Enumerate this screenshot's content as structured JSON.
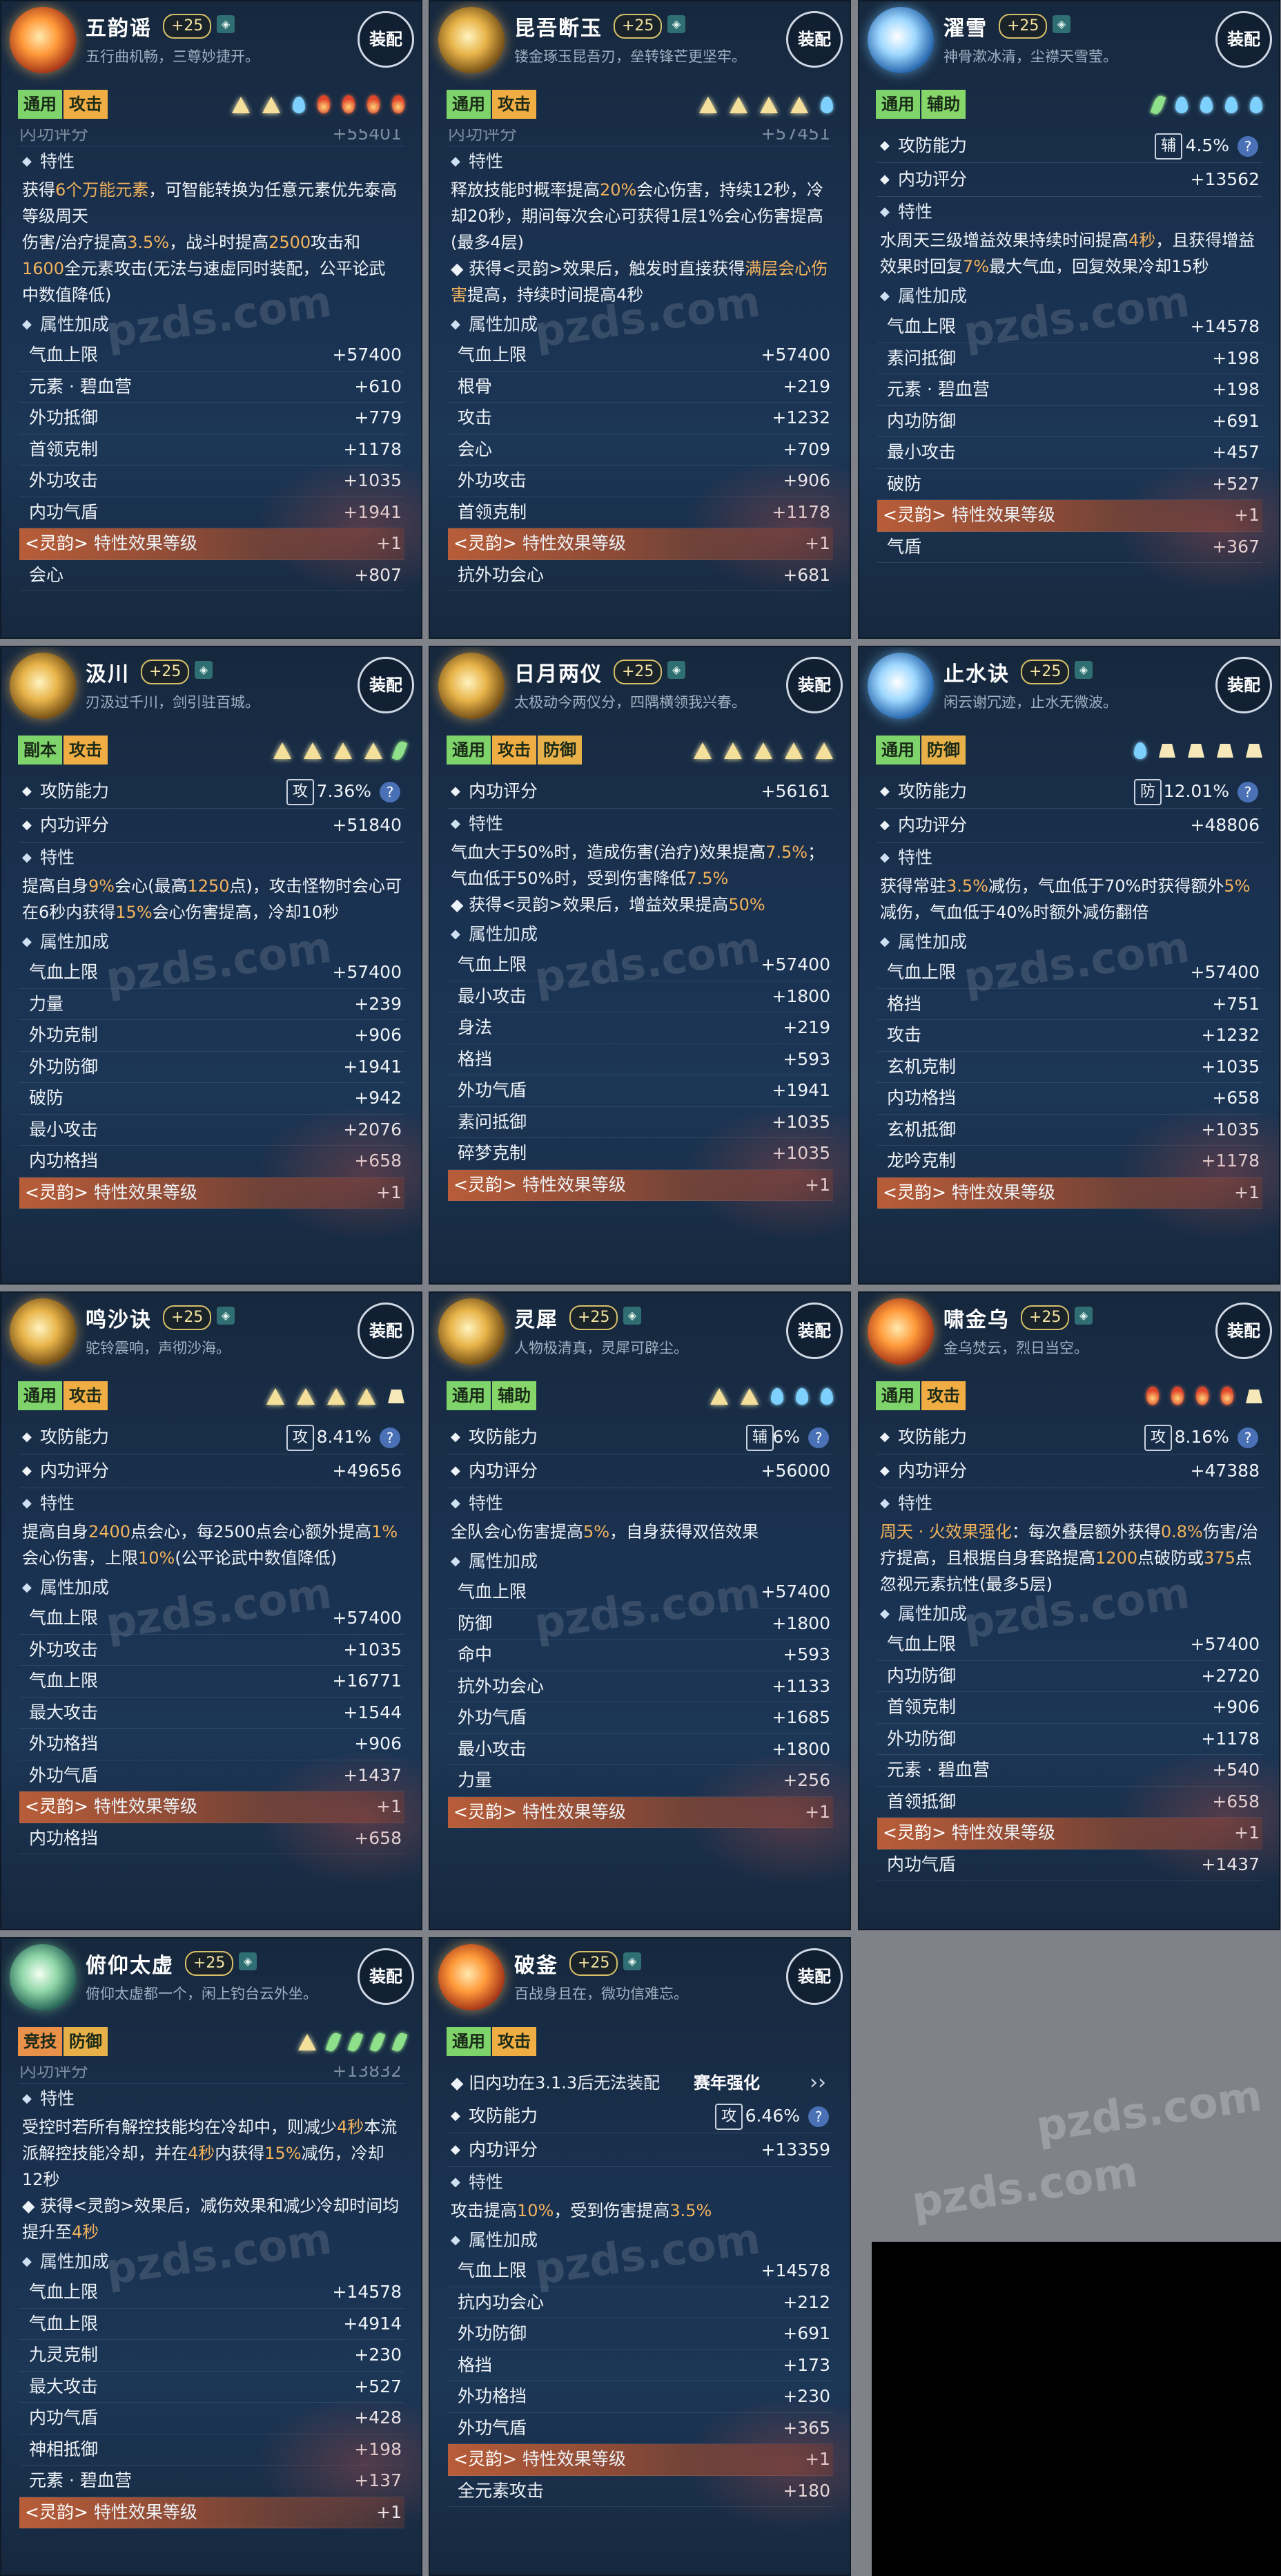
{
  "equip_label": "装配",
  "section_labels": {
    "trait": "特性",
    "attributes": "属性加成",
    "attack_defense": "攻防能力",
    "inner_score": "内功评分"
  },
  "watermark_text": "pzds.com",
  "cards": [
    {
      "name": "五韵谣",
      "plus": "+25",
      "motto": "五行曲机畅，三尊妙捷开。",
      "emblem": "fire",
      "tags": [
        {
          "label": "通用",
          "type": "general"
        },
        {
          "label": "攻击",
          "type": "attack"
        }
      ],
      "gems": [
        "tri",
        "tri",
        "drop",
        "flame",
        "flame",
        "flame",
        "flame"
      ],
      "top_row": {
        "label": "内功评分",
        "value": "+55401",
        "dimmed": true
      },
      "trait_html": "获得<span class='hl'>6个万能元素</span>，可智能转换为任意元素优先泰高等级周天<br>伤害/治疗提高<span class='hl'>3.5%</span>，战斗时提高<span class='hl'>2500</span>攻击和<span class='hl'>1600</span>全元素攻击(无法与速虚同时装配，公平论武中数值降低)",
      "stats": [
        {
          "k": "气血上限",
          "v": "+57400"
        },
        {
          "k": "元素 · 碧血营",
          "v": "+610"
        },
        {
          "k": "外功抵御",
          "v": "+779"
        },
        {
          "k": "首领克制",
          "v": "+1178"
        },
        {
          "k": "外功攻击",
          "v": "+1035"
        },
        {
          "k": "内功气盾",
          "v": "+1941"
        },
        {
          "ling": true,
          "k": "特性效果等级",
          "v": "+1"
        },
        {
          "k": "会心",
          "v": "+807"
        }
      ]
    },
    {
      "name": "昆吾断玉",
      "plus": "+25",
      "motto": "镂金琢玉昆吾刃，垒转锋芒更坚牢。",
      "emblem": "gold",
      "tags": [
        {
          "label": "通用",
          "type": "general"
        },
        {
          "label": "攻击",
          "type": "attack"
        }
      ],
      "gems": [
        "tri",
        "tri",
        "tri",
        "tri",
        "drop"
      ],
      "top_row": {
        "label": "内功评分",
        "value": "+57451",
        "dimmed": true
      },
      "trait_html": "释放技能时概率提高<span class='hl'>20%</span>会心伤害，持续12秒，冷却20秒，期间每次会心可获得1层1%会心伤害提高(最多4层)<br><span class='bul'>◆ 获得&lt;灵韵&gt;效果后，触发时直接获得<span class='hl'>满层会心伤害</span>提高，持续时间提高4秒</span>",
      "stats": [
        {
          "k": "气血上限",
          "v": "+57400"
        },
        {
          "k": "根骨",
          "v": "+219"
        },
        {
          "k": "攻击",
          "v": "+1232"
        },
        {
          "k": "会心",
          "v": "+709"
        },
        {
          "k": "外功攻击",
          "v": "+906"
        },
        {
          "k": "首领克制",
          "v": "+1178"
        },
        {
          "ling": true,
          "k": "特性效果等级",
          "v": "+1"
        },
        {
          "k": "抗外功会心",
          "v": "+681"
        }
      ]
    },
    {
      "name": "濯雪",
      "plus": "+25",
      "motto": "神骨漱冰清，尘襟天雪莹。",
      "emblem": "ice",
      "tags": [
        {
          "label": "通用",
          "type": "general"
        },
        {
          "label": "辅助",
          "type": "assist"
        }
      ],
      "gems": [
        "leaf",
        "drop",
        "drop",
        "drop",
        "drop"
      ],
      "ad": {
        "cap": "辅",
        "pct": "4.5%"
      },
      "score": "+13562",
      "trait_html": "水周天三级增益效果持续时间提高<span class='hl'>4秒</span>，且获得增益效果时回复<span class='hl'>7%</span>最大气血，回复效果冷却15秒",
      "stats": [
        {
          "k": "气血上限",
          "v": "+14578"
        },
        {
          "k": "素问抵御",
          "v": "+198"
        },
        {
          "k": "元素 · 碧血营",
          "v": "+198"
        },
        {
          "k": "内功防御",
          "v": "+691"
        },
        {
          "k": "最小攻击",
          "v": "+457"
        },
        {
          "k": "破防",
          "v": "+527"
        },
        {
          "ling": true,
          "k": "特性效果等级",
          "v": "+1"
        },
        {
          "k": "气盾",
          "v": "+367"
        }
      ]
    },
    {
      "name": "汲川",
      "plus": "+25",
      "motto": "刃汲过千川，剑引驻百城。",
      "emblem": "gold",
      "tags": [
        {
          "label": "副本",
          "type": "dungeon"
        },
        {
          "label": "攻击",
          "type": "attack"
        }
      ],
      "gems": [
        "tri",
        "tri",
        "tri",
        "tri",
        "leaf"
      ],
      "ad": {
        "cap": "攻",
        "pct": "7.36%"
      },
      "score": "+51840",
      "trait_html": "提高自身<span class='hl'>9%</span>会心(最高<span class='hl'>1250</span>点)，攻击怪物时会心可在6秒内获得<span class='hl'>15%</span>会心伤害提高，冷却10秒",
      "stats": [
        {
          "k": "气血上限",
          "v": "+57400"
        },
        {
          "k": "力量",
          "v": "+239"
        },
        {
          "k": "外功克制",
          "v": "+906"
        },
        {
          "k": "外功防御",
          "v": "+1941"
        },
        {
          "k": "破防",
          "v": "+942"
        },
        {
          "k": "最小攻击",
          "v": "+2076"
        },
        {
          "k": "内功格挡",
          "v": "+658"
        },
        {
          "ling": true,
          "k": "特性效果等级",
          "v": "+1"
        }
      ]
    },
    {
      "name": "日月两仪",
      "plus": "+25",
      "motto": "太极动今两仪分，四隅横领我兴春。",
      "emblem": "gold",
      "tags": [
        {
          "label": "通用",
          "type": "general"
        },
        {
          "label": "攻击",
          "type": "attack"
        },
        {
          "label": "防御",
          "type": "defense"
        }
      ],
      "gems": [
        "tri",
        "tri",
        "tri",
        "tri",
        "tri"
      ],
      "score": "+56161",
      "trait_html": "气血大于50%时，造成伤害(治疗)效果提高<span class='hl'>7.5%</span>；气血低于50%时，受到伤害降低<span class='hl'>7.5%</span><br><span class='bul'>◆ 获得&lt;灵韵&gt;效果后，增益效果提高<span class='hl'>50%</span></span>",
      "stats": [
        {
          "k": "气血上限",
          "v": "+57400"
        },
        {
          "k": "最小攻击",
          "v": "+1800"
        },
        {
          "k": "身法",
          "v": "+219"
        },
        {
          "k": "格挡",
          "v": "+593"
        },
        {
          "k": "外功气盾",
          "v": "+1941"
        },
        {
          "k": "素问抵御",
          "v": "+1035"
        },
        {
          "k": "碎梦克制",
          "v": "+1035"
        },
        {
          "ling": true,
          "k": "特性效果等级",
          "v": "+1"
        }
      ]
    },
    {
      "name": "止水诀",
      "plus": "+25",
      "motto": "闲云谢冗迹，止水无微波。",
      "emblem": "ice",
      "tags": [
        {
          "label": "通用",
          "type": "general"
        },
        {
          "label": "防御",
          "type": "defense"
        }
      ],
      "gems": [
        "drop",
        "block",
        "block",
        "block",
        "block"
      ],
      "ad": {
        "cap": "防",
        "pct": "12.01%"
      },
      "score": "+48806",
      "trait_html": "获得常驻<span class='hl'>3.5%</span>减伤，气血低于70%时获得额外<span class='hl'>5%</span>减伤，气血低于40%时额外减伤翻倍",
      "stats": [
        {
          "k": "气血上限",
          "v": "+57400"
        },
        {
          "k": "格挡",
          "v": "+751"
        },
        {
          "k": "攻击",
          "v": "+1232"
        },
        {
          "k": "玄机克制",
          "v": "+1035"
        },
        {
          "k": "内功格挡",
          "v": "+658"
        },
        {
          "k": "玄机抵御",
          "v": "+1035"
        },
        {
          "k": "龙吟克制",
          "v": "+1178"
        },
        {
          "ling": true,
          "k": "特性效果等级",
          "v": "+1"
        }
      ]
    },
    {
      "name": "鸣沙诀",
      "plus": "+25",
      "motto": "驼铃震响，声彻沙海。",
      "emblem": "gold",
      "tags": [
        {
          "label": "通用",
          "type": "general"
        },
        {
          "label": "攻击",
          "type": "attack"
        }
      ],
      "gems": [
        "tri",
        "tri",
        "tri",
        "tri",
        "block"
      ],
      "ad": {
        "cap": "攻",
        "pct": "8.41%"
      },
      "score": "+49656",
      "trait_html": "提高自身<span class='hl'>2400</span>点会心，每2500点会心额外提高<span class='hl'>1%</span>会心伤害，上限<span class='hl'>10%</span>(公平论武中数值降低)",
      "stats": [
        {
          "k": "气血上限",
          "v": "+57400"
        },
        {
          "k": "外功攻击",
          "v": "+1035"
        },
        {
          "k": "气血上限",
          "v": "+16771"
        },
        {
          "k": "最大攻击",
          "v": "+1544"
        },
        {
          "k": "外功格挡",
          "v": "+906"
        },
        {
          "k": "外功气盾",
          "v": "+1437"
        },
        {
          "ling": true,
          "k": "特性效果等级",
          "v": "+1"
        },
        {
          "k": "内功格挡",
          "v": "+658"
        }
      ]
    },
    {
      "name": "灵犀",
      "plus": "+25",
      "motto": "人物极清真，灵犀可辟尘。",
      "emblem": "gold",
      "tags": [
        {
          "label": "通用",
          "type": "general"
        },
        {
          "label": "辅助",
          "type": "assist"
        }
      ],
      "gems": [
        "tri",
        "tri",
        "drop",
        "drop",
        "drop"
      ],
      "ad": {
        "cap": "辅",
        "pct": "6%"
      },
      "score": "+56000",
      "trait_html": "全队会心伤害提高<span class='hl'>5%</span>，自身获得双倍效果",
      "stats": [
        {
          "k": "气血上限",
          "v": "+57400"
        },
        {
          "k": "防御",
          "v": "+1800"
        },
        {
          "k": "命中",
          "v": "+593"
        },
        {
          "k": "抗外功会心",
          "v": "+1133"
        },
        {
          "k": "外功气盾",
          "v": "+1685"
        },
        {
          "k": "最小攻击",
          "v": "+1800"
        },
        {
          "k": "力量",
          "v": "+256"
        },
        {
          "ling": true,
          "k": "特性效果等级",
          "v": "+1"
        }
      ]
    },
    {
      "name": "啸金乌",
      "plus": "+25",
      "motto": "金乌焚云，烈日当空。",
      "emblem": "fire",
      "tags": [
        {
          "label": "通用",
          "type": "general"
        },
        {
          "label": "攻击",
          "type": "attack"
        }
      ],
      "gems": [
        "flame",
        "flame",
        "flame",
        "flame",
        "block"
      ],
      "ad": {
        "cap": "攻",
        "pct": "8.16%"
      },
      "score": "+47388",
      "trait_html": "<span class='hl'>周天 · 火效果强化</span>：每次叠层额外获得<span class='hl'>0.8%</span>伤害/治疗提高，且根据自身套路提高<span class='hl'>1200</span>点破防或<span class='hl'>375</span>点忽视元素抗性(最多5层)",
      "stats": [
        {
          "k": "气血上限",
          "v": "+57400"
        },
        {
          "k": "内功防御",
          "v": "+2720"
        },
        {
          "k": "首领克制",
          "v": "+906"
        },
        {
          "k": "外功防御",
          "v": "+1178"
        },
        {
          "k": "元素 · 碧血营",
          "v": "+540"
        },
        {
          "k": "首领抵御",
          "v": "+658"
        },
        {
          "ling": true,
          "k": "特性效果等级",
          "v": "+1"
        },
        {
          "k": "内功气盾",
          "v": "+1437"
        }
      ]
    },
    {
      "name": "俯仰太虚",
      "plus": "+25",
      "motto": "俯仰太虚都一个，闲上钓台云外坐。",
      "emblem": "teal",
      "tags": [
        {
          "label": "竞技",
          "type": "arena"
        },
        {
          "label": "防御",
          "type": "defense"
        }
      ],
      "gems": [
        "tri",
        "leaf",
        "leaf",
        "leaf",
        "leaf"
      ],
      "top_row": {
        "label": "内功评分",
        "value": "+13832",
        "dimmed": true
      },
      "trait_html": "受控时若所有解控技能均在冷却中，则减少<span class='hl'>4秒</span>本流派解控技能冷却，并在<span class='hl'>4秒</span>内获得<span class='hl'>15%</span>减伤，冷却12秒<br><span class='bul'>◆ 获得&lt;灵韵&gt;效果后，减伤效果和减少冷却时间均提升至<span class='hl'>4秒</span></span>",
      "stats": [
        {
          "k": "气血上限",
          "v": "+14578"
        },
        {
          "k": "气血上限",
          "v": "+4914"
        },
        {
          "k": "九灵克制",
          "v": "+230"
        },
        {
          "k": "最大攻击",
          "v": "+527"
        },
        {
          "k": "内功气盾",
          "v": "+428"
        },
        {
          "k": "神相抵御",
          "v": "+198"
        },
        {
          "k": "元素 · 碧血营",
          "v": "+137"
        },
        {
          "ling": true,
          "k": "特性效果等级",
          "v": "+1"
        }
      ]
    },
    {
      "name": "破釜",
      "plus": "+25",
      "motto": "百战身且在，微功信难忘。",
      "emblem": "fire",
      "tags": [
        {
          "label": "通用",
          "type": "general"
        },
        {
          "label": "攻击",
          "type": "attack"
        }
      ],
      "gems": [],
      "season": {
        "text": "◆ 旧内功在3.1.3后无法装配",
        "badge": "赛年强化",
        "arrow": "››"
      },
      "ad": {
        "cap": "攻",
        "pct": "6.46%"
      },
      "score": "+13359",
      "trait_html": "攻击提高<span class='hl'>10%</span>，受到伤害提高<span class='hl'>3.5%</span>",
      "stats": [
        {
          "k": "气血上限",
          "v": "+14578"
        },
        {
          "k": "抗内功会心",
          "v": "+212"
        },
        {
          "k": "外功防御",
          "v": "+691"
        },
        {
          "k": "格挡",
          "v": "+173"
        },
        {
          "k": "外功格挡",
          "v": "+230"
        },
        {
          "k": "外功气盾",
          "v": "+365"
        },
        {
          "ling": true,
          "k": "特性效果等级",
          "v": "+1"
        },
        {
          "k": "全元素攻击",
          "v": "+180"
        }
      ]
    }
  ],
  "ling_prefix": "<灵韵>"
}
